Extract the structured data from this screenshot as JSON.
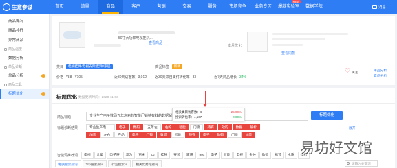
{
  "app": {
    "title": "生意参谋"
  },
  "nav": {
    "items": [
      "首页",
      "流量",
      "商品",
      "客户",
      "营销",
      "交易",
      "服务",
      "市场竞争",
      "业务专区",
      "爆款实验室",
      "数据学院"
    ],
    "active_index": 2,
    "new_badge": "NEW",
    "message": "消息"
  },
  "sidebar": {
    "top_items": [
      "商品概况",
      "商品排行",
      "异常商品"
    ],
    "groups": [
      {
        "label": "商品温度",
        "items": [
          "数据分析"
        ]
      },
      {
        "label": "单品诊断",
        "items": [
          "单品分析"
        ]
      },
      {
        "label": "商品工具",
        "items": [
          "标题优化"
        ]
      }
    ],
    "active": "标题优化"
  },
  "product": {
    "title": "50寸大功率电视挂机...",
    "view_link": "查看商品",
    "same_label": "本月优化",
    "same_link": "查看同款",
    "category_label": "类目",
    "category_value": "电视挂件/电视支架/配件/家居",
    "attr_label": "商品标签",
    "attr_value": "新款",
    "price_label": "价格",
    "price_value": "¥88 - ¥105",
    "visitors_label": "近30天访客数",
    "visitors_value": "3,012",
    "pay_label": "近30天来自支付转化率",
    "pay_value": "83",
    "growth_label": "近7天商品增长",
    "growth_value": "34%",
    "fav_label": "关注",
    "link_right_1": "单品分析",
    "link_right_2": "竞品分析"
  },
  "title_opt": {
    "heading": "标题优化",
    "time": "数据更新时间：2020-11-03",
    "input_label": "商品标题",
    "input_value": "专业生产电子数码五年左右的智能门锁持有效的数据解析加装",
    "button": "标题优化",
    "popup": {
      "row1_label": "相关类目访客数：6",
      "row1_value": "-25.00%",
      "row2_label": "搜索转化率：4,167",
      "row2_value": "0.00%"
    },
    "diag_label": "标题诊断结果",
    "chips_row1": [
      "专业生产电",
      "电子",
      "数码",
      "五年左",
      "右的",
      "智能",
      "门锁",
      "持有",
      "效的",
      "数据",
      "解析"
    ],
    "chips_row2": [
      "加装",
      "左右",
      "产品",
      "电子",
      "门锁",
      "数码",
      "智能",
      "持有",
      "电子",
      "数码",
      "门锁",
      "加装"
    ],
    "expand_link": "展开",
    "words_label": "智能词推荐词",
    "words": [
      "电视",
      "儿童",
      "电子秤",
      "华为",
      "百米",
      "山",
      "挂钟",
      "安装",
      "家用",
      "test",
      "电子",
      "智能",
      "电视",
      "金钟",
      "数码",
      "机顶",
      "木质",
      "挂机"
    ],
    "tabs": [
      "相关搜索热词",
      "Top搜索热词",
      "行业搜索词",
      "相关优秀标题词"
    ],
    "search_placeholder": "请输入关键词"
  },
  "watermark": "易坊好文馆",
  "colors": {
    "primary": "#2f7df5",
    "highlight": "#e9453f",
    "accent": "#f5a623"
  }
}
